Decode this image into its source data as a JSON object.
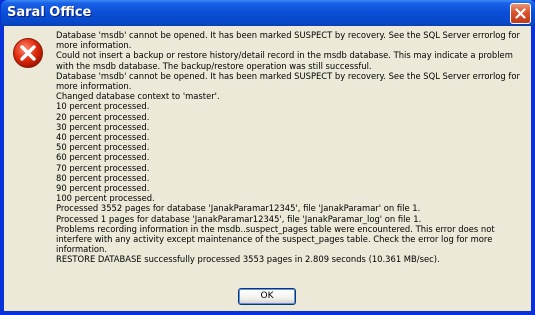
{
  "window": {
    "title": "Saral Office",
    "close_icon": "close-icon"
  },
  "dialog": {
    "icon": "error-icon",
    "messages": [
      "Database 'msdb' cannot be opened. It has been marked SUSPECT by recovery. See the SQL Server errorlog for more information.",
      "Could not insert a backup or restore history/detail record in the msdb database. This may indicate a problem with the msdb database. The backup/restore operation was still successful.",
      "Database 'msdb' cannot be opened. It has been marked SUSPECT by recovery. See the SQL Server errorlog for more information.",
      "Changed database context to 'master'.",
      "10 percent processed.",
      "20 percent processed.",
      "30 percent processed.",
      "40 percent processed.",
      "50 percent processed.",
      "60 percent processed.",
      "70 percent processed.",
      "80 percent processed.",
      "90 percent processed.",
      "100 percent processed.",
      "Processed 3552 pages for database 'JanakParamar12345', file 'JanakParamar' on file 1.",
      "Processed 1 pages for database 'JanakParamar12345', file 'JanakParamar_log' on file 1.",
      "Problems recording information in the msdb..suspect_pages table were encountered. This error does not interfere with any activity except maintenance of the suspect_pages table. Check the error log for more information.",
      "RESTORE DATABASE successfully processed 3553 pages in 2.809 seconds (10.361 MB/sec)."
    ],
    "ok_label": "OK"
  }
}
